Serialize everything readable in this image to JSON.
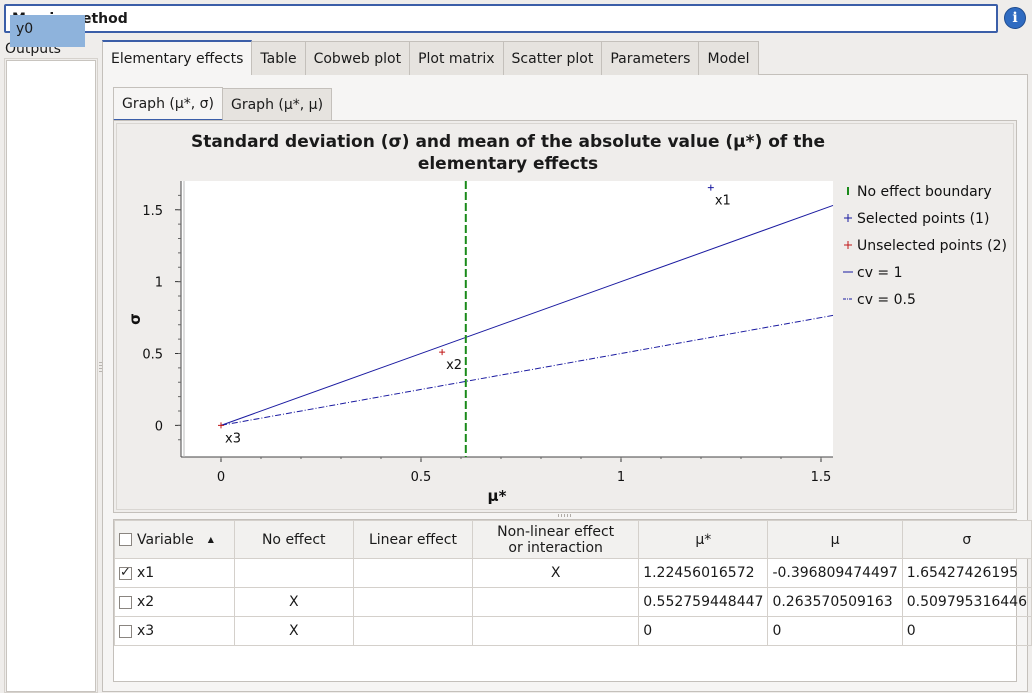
{
  "window": {
    "title": "Morris method",
    "info_icon": "info-icon"
  },
  "outputs": {
    "label": "Outputs",
    "items": [
      "y0"
    ],
    "selected": "y0"
  },
  "main_tabs": [
    "Elementary effects",
    "Table",
    "Cobweb plot",
    "Plot matrix",
    "Scatter plot",
    "Parameters",
    "Model"
  ],
  "active_main_tab": "Elementary effects",
  "sub_tabs": [
    "Graph (μ*, σ)",
    "Graph (μ*, μ)"
  ],
  "active_sub_tab": "Graph (μ*, σ)",
  "chart_data": {
    "type": "scatter",
    "title_line1": "Standard deviation (σ) and mean of the absolute value (μ*) of the",
    "title_line2": "elementary effects",
    "xlabel": "μ*",
    "ylabel": "σ",
    "xlim": [
      -0.1,
      1.53
    ],
    "ylim": [
      -0.22,
      1.7
    ],
    "xticks": [
      0,
      0.5,
      1,
      1.5
    ],
    "yticks": [
      0,
      0.5,
      1,
      1.5
    ],
    "xtick_labels": [
      "0",
      "0.5",
      "1",
      "1.5"
    ],
    "ytick_labels": [
      "0",
      "0.5",
      "1",
      "1.5"
    ],
    "no_effect_boundary": 0.612,
    "cv_lines": [
      1,
      0.5
    ],
    "points": [
      {
        "name": "x1",
        "x": 1.22456016572,
        "y": 1.65427426195,
        "selected": true
      },
      {
        "name": "x2",
        "x": 0.552759448447,
        "y": 0.509795316446,
        "selected": false
      },
      {
        "name": "x3",
        "x": 0,
        "y": 0,
        "selected": false
      }
    ],
    "legend": [
      {
        "label": "No effect boundary",
        "color": "#1a8a1a",
        "marker": "bar"
      },
      {
        "label": "Selected points (1)",
        "color": "#1a1aa0",
        "marker": "plus"
      },
      {
        "label": "Unselected points (2)",
        "color": "#c01818",
        "marker": "plus"
      },
      {
        "label": "cv = 1",
        "color": "#1a1aa0",
        "marker": "line"
      },
      {
        "label": "cv = 0.5",
        "color": "#1a1aa0",
        "marker": "dashdot"
      }
    ],
    "colors": {
      "boundary": "#1a8a1a",
      "selected": "#1a1aa0",
      "unselected": "#c01818",
      "cv": "#1a1aa0"
    }
  },
  "table": {
    "headers": [
      "Variable",
      "No effect",
      "Linear effect",
      "Non-linear effect\nor interaction",
      "μ*",
      "μ",
      "σ"
    ],
    "rows": [
      {
        "checked": true,
        "variable": "x1",
        "no_effect": "",
        "linear": "",
        "nonlinear": "X",
        "mu_star": "1.22456016572",
        "mu": "-0.396809474497",
        "sigma": "1.65427426195"
      },
      {
        "checked": false,
        "variable": "x2",
        "no_effect": "X",
        "linear": "",
        "nonlinear": "",
        "mu_star": "0.552759448447",
        "mu": "0.263570509163",
        "sigma": "0.509795316446"
      },
      {
        "checked": false,
        "variable": "x3",
        "no_effect": "X",
        "linear": "",
        "nonlinear": "",
        "mu_star": "0",
        "mu": "0",
        "sigma": "0"
      }
    ]
  }
}
